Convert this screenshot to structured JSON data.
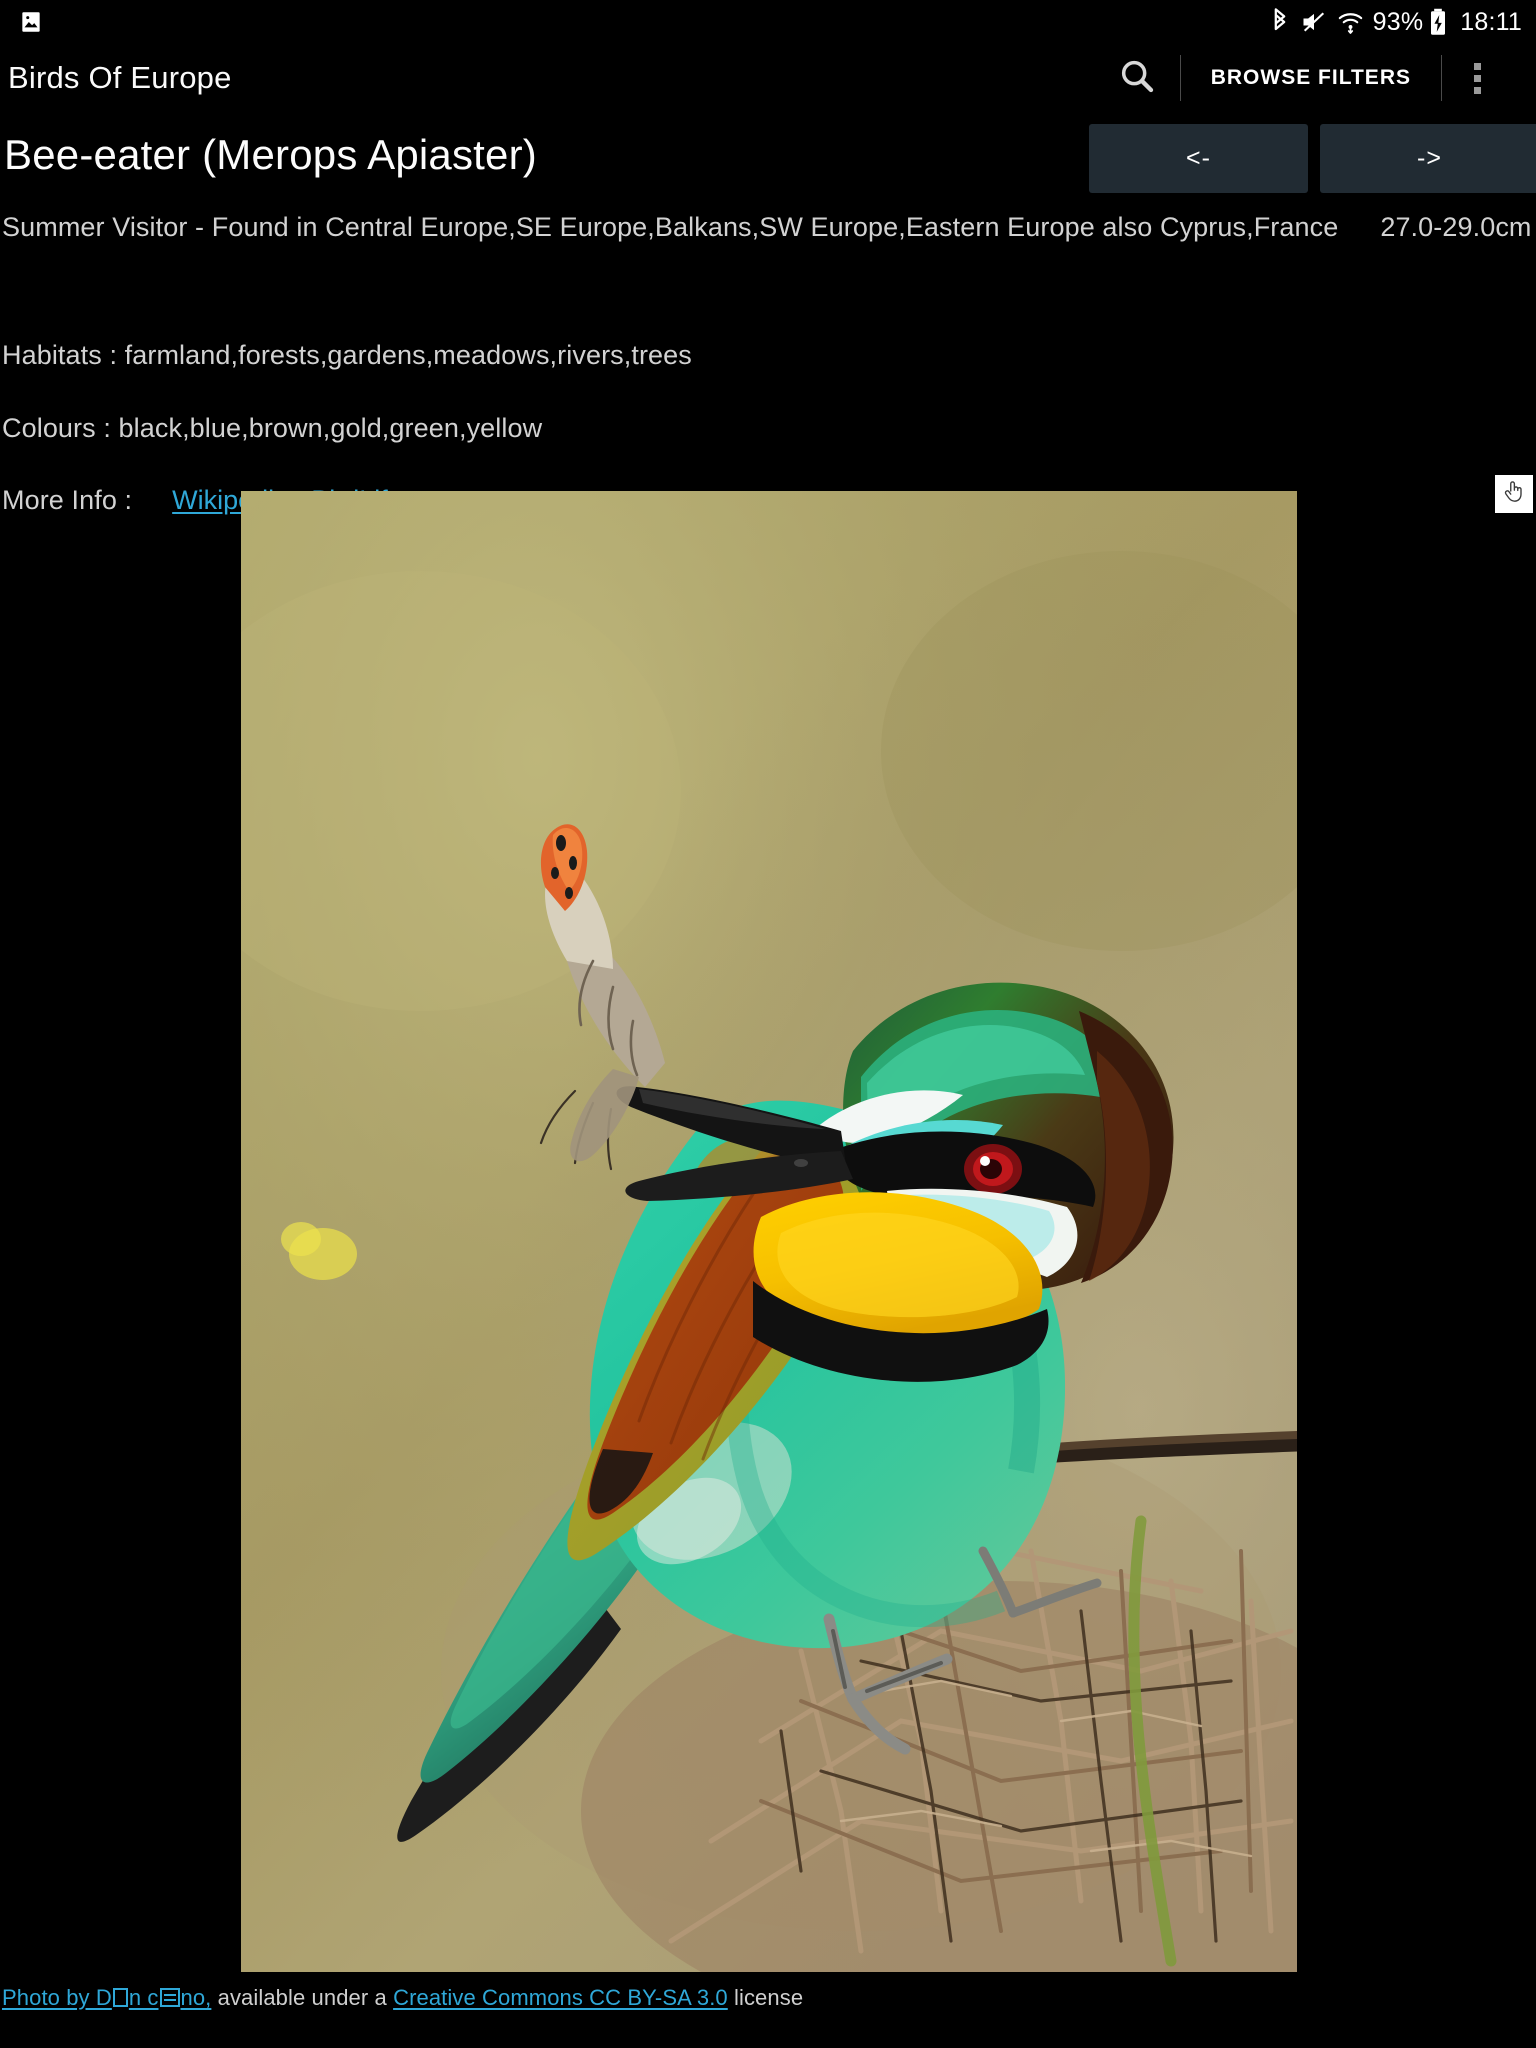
{
  "status_bar": {
    "left_icon": "image-icon",
    "icons": [
      "bluetooth-icon",
      "volume-mute-icon",
      "wifi-icon"
    ],
    "battery_percent": "93%",
    "battery_icon": "battery-charging-icon",
    "time": "18:11"
  },
  "app_bar": {
    "title": "Birds Of Europe",
    "search_icon": "search-icon",
    "browse_filters_label": "BROWSE FILTERS",
    "overflow_icon": "overflow-menu-icon"
  },
  "bird": {
    "title": "Bee-eater (Merops Apiaster)",
    "status_and_range": "Summer Visitor - Found in Central Europe,SE Europe,Balkans,SW Europe,Eastern Europe also Cyprus,France",
    "size": "27.0-29.0cm",
    "habitats": "Habitats : farmland,forests,gardens,meadows,rivers,trees",
    "colours": "Colours : black,blue,brown,gold,green,yellow",
    "more_info_label": "More Info  :",
    "links": [
      {
        "label": "Wikipedia"
      },
      {
        "label": "BirdLife"
      }
    ]
  },
  "navigation": {
    "prev_label": "<-",
    "next_label": "->"
  },
  "cursor_badge": {
    "icon": "hand-pointer-icon"
  },
  "photo": {
    "alt": "European bee-eater perched on a thorny branch holding a butterfly in its beak"
  },
  "caption": {
    "photo_by_prefix": "Photo by D",
    "photo_by_mid": "n c",
    "photo_by_suffix": "no,",
    "middle_text": " available under a ",
    "license_link": "Creative Commons CC BY-SA 3.0",
    "suffix_text": " license"
  },
  "colors": {
    "background": "#000000",
    "link": "#2fa8d8",
    "button_bg": "#212b33",
    "text_primary": "#ffffff",
    "text_secondary": "#d2d2d2"
  }
}
